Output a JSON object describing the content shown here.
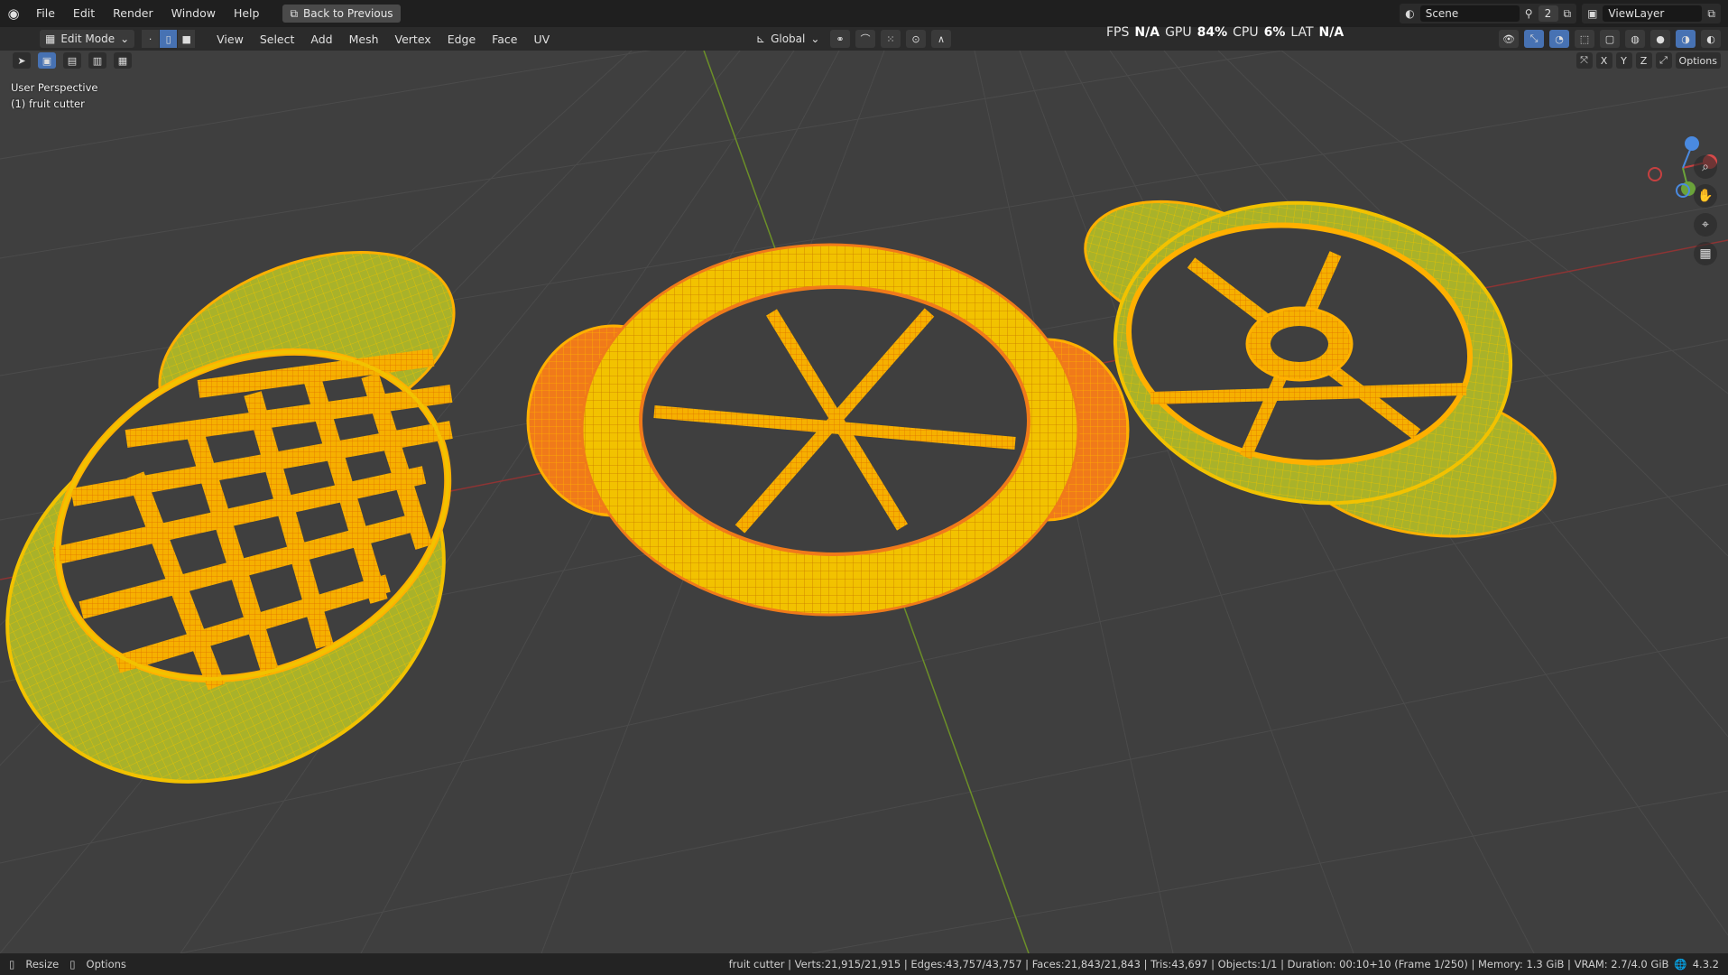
{
  "menu": {
    "items": [
      "File",
      "Edit",
      "Render",
      "Window",
      "Help"
    ],
    "back_label": "Back to Previous"
  },
  "top_right": {
    "scene": "Scene",
    "scene_count": "2",
    "view_layer": "ViewLayer"
  },
  "header": {
    "mode": "Edit Mode",
    "menus": [
      "View",
      "Select",
      "Add",
      "Mesh",
      "Vertex",
      "Edge",
      "Face",
      "UV"
    ],
    "orientation": "Global"
  },
  "stats": {
    "fps_label": "FPS",
    "fps": "N/A",
    "gpu_label": "GPU",
    "gpu": "84%",
    "cpu_label": "CPU",
    "cpu": "6%",
    "lat_label": "LAT",
    "lat": "N/A"
  },
  "viewport": {
    "perspective": "User Perspective",
    "object": "(1) fruit cutter",
    "options_label": "Options",
    "axes": [
      "X",
      "Y",
      "Z"
    ]
  },
  "statusbar": {
    "left": [
      "Resize",
      "Options"
    ],
    "info": "fruit cutter | Verts:21,915/21,915 | Edges:43,757/43,757 | Faces:21,843/21,843 | Tris:43,697 | Objects:1/1 | Duration: 00:10+10 (Frame 1/250) | Memory: 1.3 GiB | VRAM: 2.7/4.0 GiB",
    "version": "4.3.2"
  },
  "colors": {
    "mesh_yellow": "#f2c200",
    "mesh_orange": "#f07a1a",
    "grid": "#4a4a4a",
    "axis_x": "#a33a3a",
    "axis_y": "#6c8f28",
    "selected_edge": "#ff8c00"
  }
}
